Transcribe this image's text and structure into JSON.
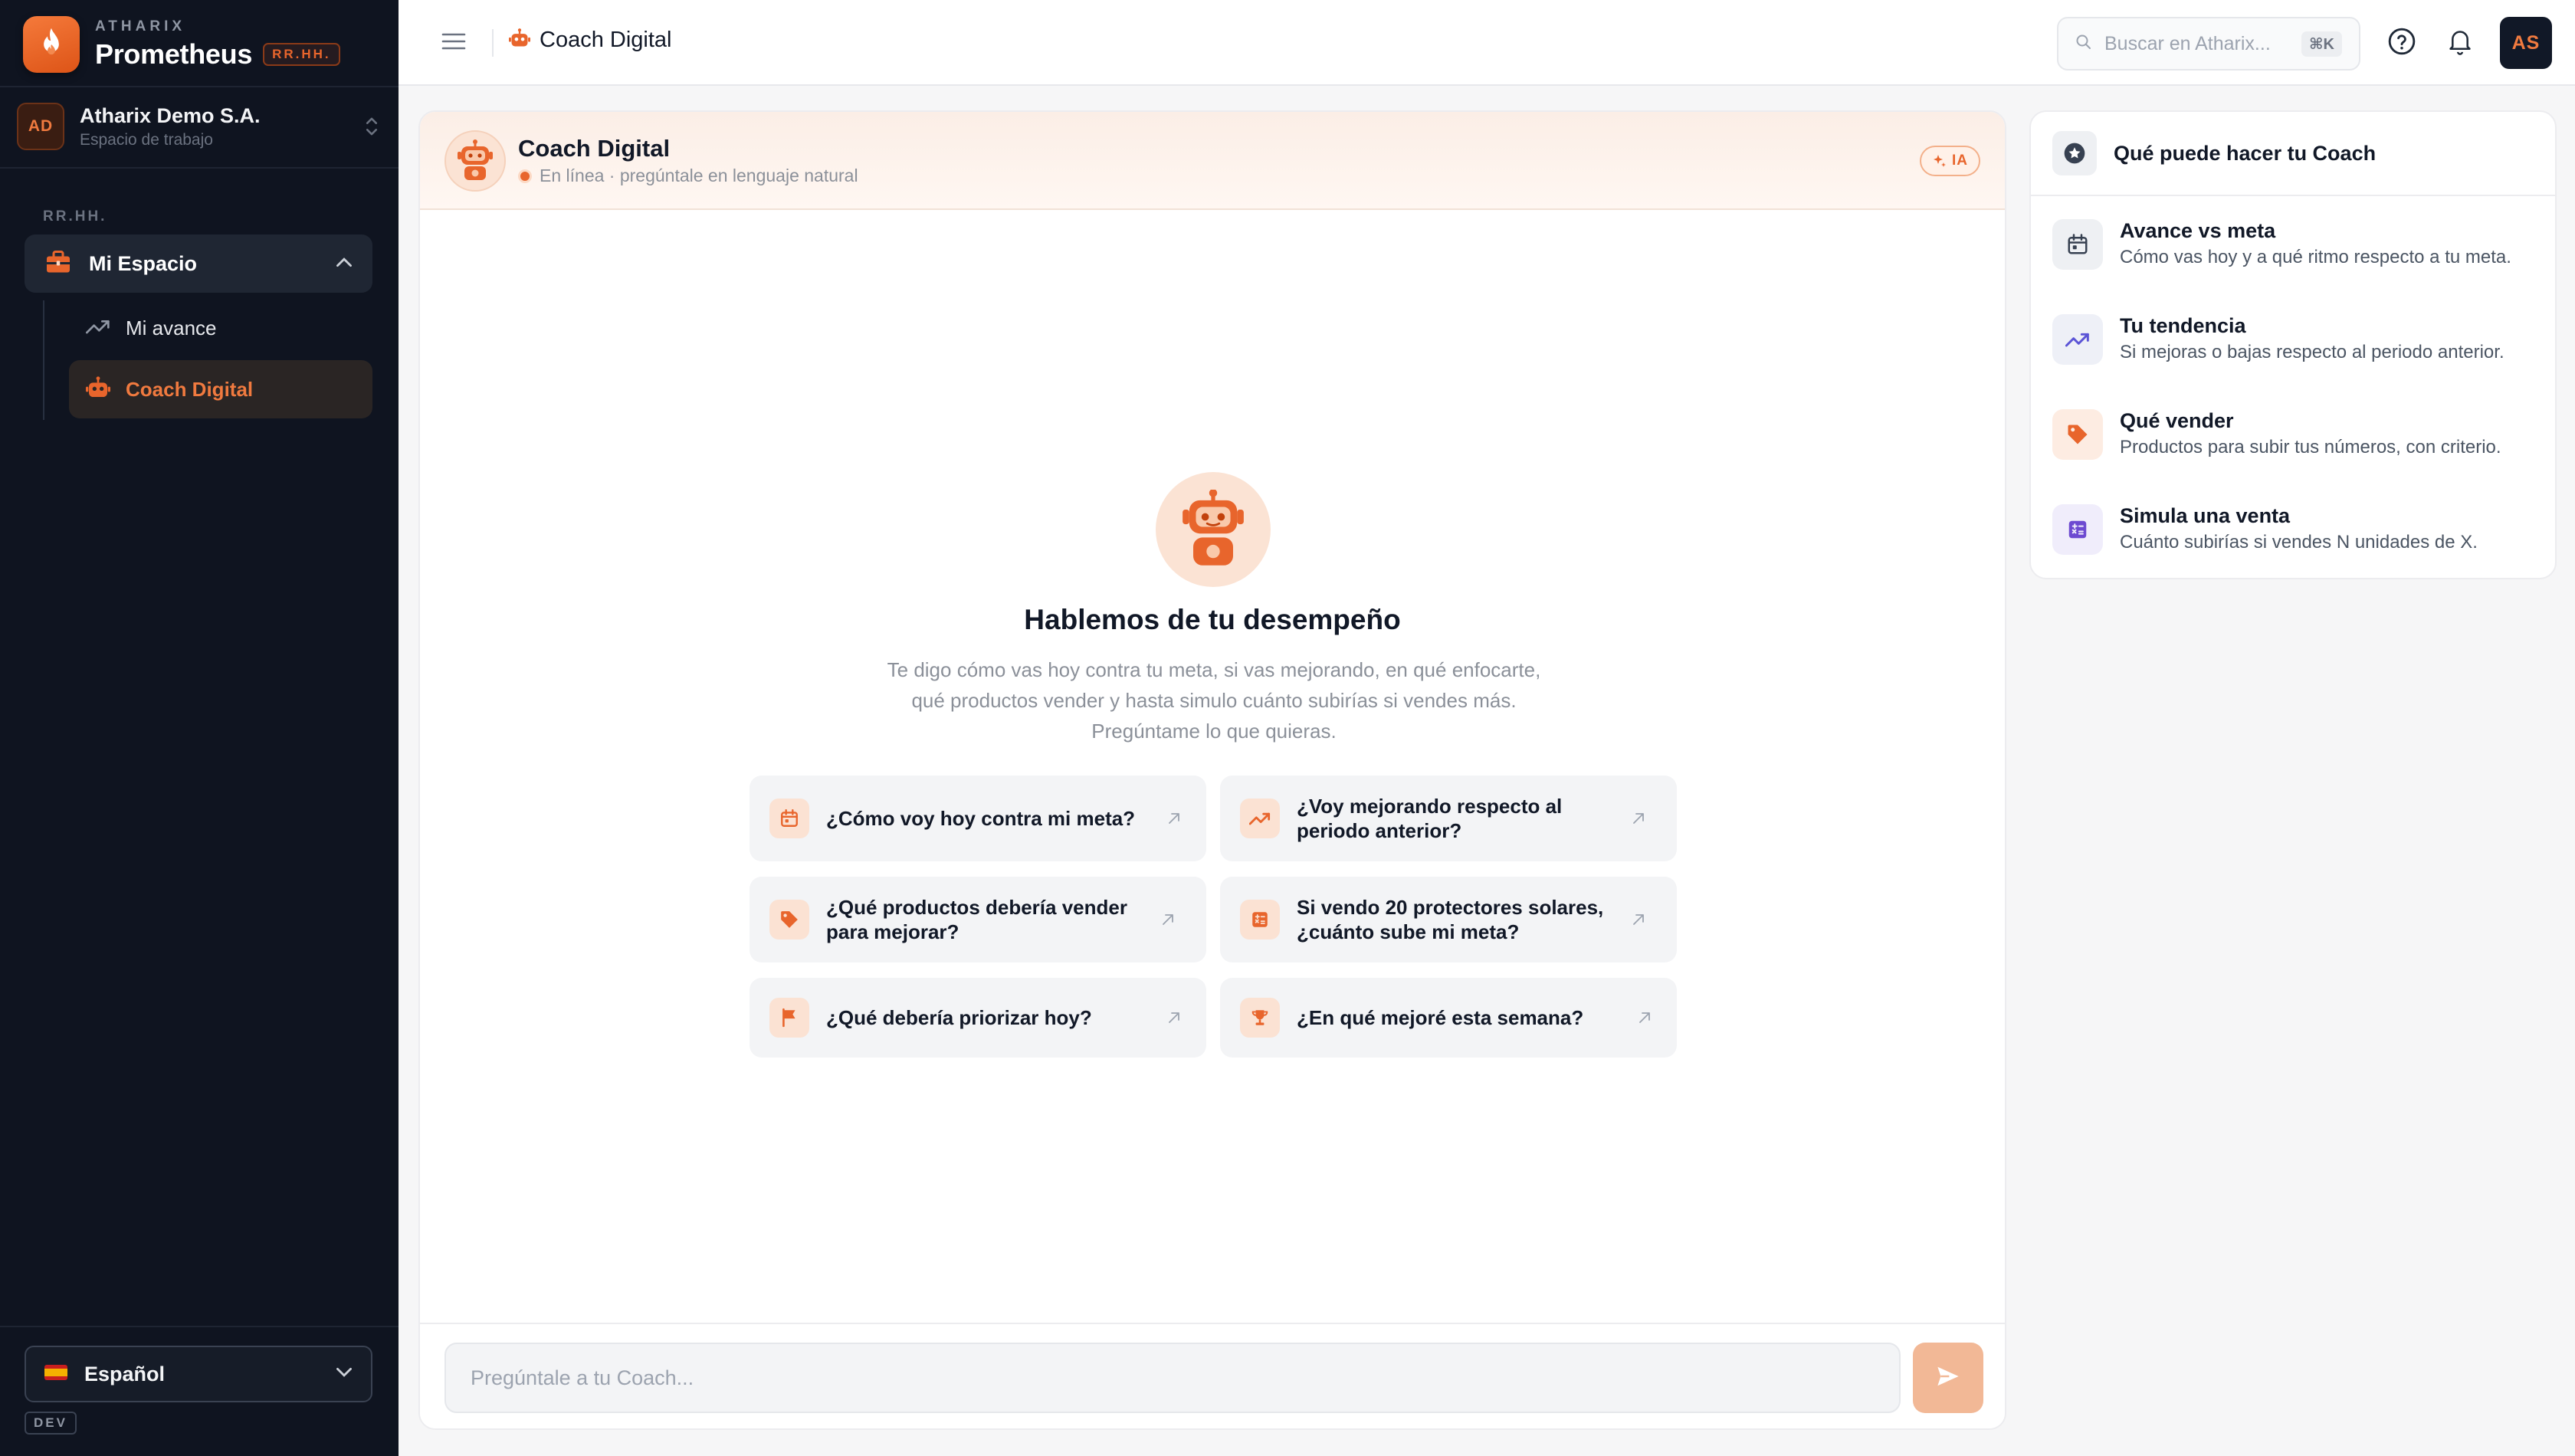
{
  "brand": {
    "kicker": "ATHARIX",
    "name": "Prometheus",
    "tag": "RR.HH."
  },
  "workspace": {
    "initials": "AD",
    "name": "Atharix Demo S.A.",
    "subtitle": "Espacio de trabajo"
  },
  "sidebar": {
    "section_label": "RR.HH.",
    "group": {
      "label": "Mi Espacio",
      "icon": "briefcase-icon"
    },
    "items": [
      {
        "label": "Mi avance",
        "icon": "trending-up-icon"
      },
      {
        "label": "Coach Digital",
        "icon": "robot-icon",
        "active": true
      }
    ],
    "language": "Español",
    "env_badge": "DEV"
  },
  "topbar": {
    "breadcrumb": "Coach Digital",
    "search_placeholder": "Buscar en Atharix...",
    "search_shortcut": "⌘K",
    "user_initials": "AS"
  },
  "chat": {
    "title": "Coach Digital",
    "status": "En línea · pregúntale en lenguaje natural",
    "badge": "IA",
    "hero_title": "Hablemos de tu desempeño",
    "hero_subtitle_lines": [
      "Te digo cómo vas hoy contra tu meta, si vas mejorando, en qué enfocarte,",
      "qué productos vender y hasta simulo cuánto subirías si vendes más.",
      "Pregúntame lo que quieras."
    ],
    "suggestions": [
      {
        "text": "¿Cómo voy hoy contra mi meta?",
        "icon": "calendar-icon"
      },
      {
        "text": "¿Voy mejorando respecto al periodo anterior?",
        "icon": "trending-up-icon"
      },
      {
        "text": "¿Qué productos debería vender para mejorar?",
        "icon": "tag-icon"
      },
      {
        "text": "Si vendo 20 protectores solares, ¿cuánto sube mi meta?",
        "icon": "calculator-icon"
      },
      {
        "text": "¿Qué debería priorizar hoy?",
        "icon": "flag-icon"
      },
      {
        "text": "¿En qué mejoré esta semana?",
        "icon": "trophy-icon"
      }
    ],
    "input_placeholder": "Pregúntale a tu Coach..."
  },
  "capabilities": {
    "title": "Qué puede hacer tu Coach",
    "items": [
      {
        "title": "Avance vs meta",
        "desc": "Cómo vas hoy y a qué ritmo respecto a tu meta.",
        "icon": "calendar-icon"
      },
      {
        "title": "Tu tendencia",
        "desc": "Si mejoras o bajas respecto al periodo anterior.",
        "icon": "trending-up-icon"
      },
      {
        "title": "Qué vender",
        "desc": "Productos para subir tus números, con criterio.",
        "icon": "tag-icon"
      },
      {
        "title": "Simula una venta",
        "desc": "Cuánto subirías si vendes N unidades de X.",
        "icon": "calculator-icon"
      }
    ]
  },
  "colors": {
    "accent": "#e8652c",
    "sidebar_bg": "#0f1420",
    "purple_icon": "#6d4ad1"
  }
}
